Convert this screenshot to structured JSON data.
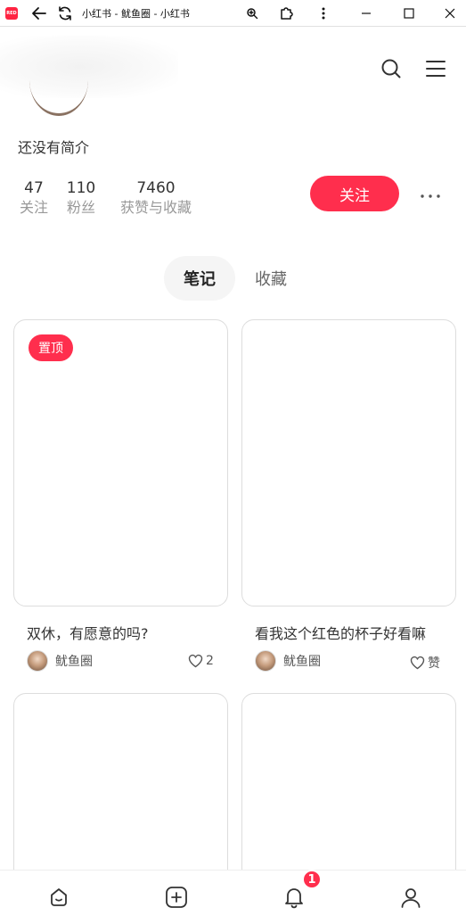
{
  "window": {
    "title": "小红书 - 鱿鱼圈 - 小红书",
    "app_logo_text": "小红书"
  },
  "profile": {
    "bio": "还没有简介",
    "stats": [
      {
        "num": "47",
        "label": "关注"
      },
      {
        "num": "110",
        "label": "粉丝"
      },
      {
        "num": "7460",
        "label": "获赞与收藏"
      }
    ],
    "follow_label": "关注"
  },
  "tabs": [
    {
      "label": "笔记",
      "active": true
    },
    {
      "label": "收藏",
      "active": false
    }
  ],
  "notes": [
    {
      "title": "双休，有愿意的吗?",
      "author": "鱿鱼圈",
      "likes": "2",
      "pinned_label": "置顶"
    },
    {
      "title": "看我这个红色的杯子好看嘛",
      "author": "鱿鱼圈",
      "likes": "赞"
    }
  ],
  "bottom_nav": {
    "items": [
      "home-icon",
      "add-icon",
      "bell-icon",
      "user-icon"
    ],
    "notification_count": "1"
  },
  "colors": {
    "accent": "#ff2e4d"
  }
}
